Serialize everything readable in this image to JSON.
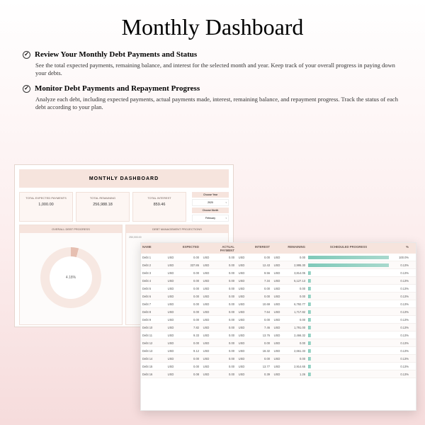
{
  "title": "Monthly Dashboard",
  "section1": {
    "heading": "Review Your Monthly Debt Payments and Status",
    "body": "See the total expected payments, remaining balance, and interest for the selected month and year. Keep track of your overall progress in paying down your debts."
  },
  "section2": {
    "heading": "Monitor Debt Payments and Repayment Progress",
    "body": "Analyze each debt, including expected payments, actual payments made, interest, remaining balance, and repayment progress. Track the status of each debt according to your plan."
  },
  "dash": {
    "heading": "MONTHLY DASHBOARD",
    "stats": {
      "expected_label": "TOTAL EXPECTED PAYMENTS",
      "expected_val": "1,000.00",
      "remaining_label": "TOTAL REMAINING",
      "remaining_val": "256,988.18",
      "interest_label": "TOTAL INTEREST",
      "interest_val": "859.46"
    },
    "choose_year": "Choose Year",
    "year": "2020",
    "choose_month": "Choose Month",
    "month": "February",
    "panel1": "OVERALL DEBT PROGRESS",
    "panel2": "DEBT MANAGEMENT PROJECTIONS",
    "donut_pct": "4.18%",
    "proj_top": "250,000.00"
  },
  "table": {
    "headers": {
      "name": "NAME",
      "expected": "EXPECTED",
      "actual": "ACTUAL PAYMENT",
      "interest": "INTEREST",
      "remaining": "REMAINING",
      "sched": "SCHEDULED PROGRESS",
      "pct": "%"
    },
    "cur": "USD",
    "chart_data": {
      "type": "table",
      "rows": [
        {
          "name": "Debt 1",
          "expected": "0.00",
          "actual": "0.00",
          "interest": "0.00",
          "remaining": "0.00",
          "bar": 100,
          "pct": "100.0%"
        },
        {
          "name": "Debt 2",
          "expected": "337.86",
          "actual": "0.00",
          "interest": "12.43",
          "remaining": "2,995.30",
          "bar": 100,
          "pct": "0.13%"
        },
        {
          "name": "Debt 3",
          "expected": "0.00",
          "actual": "0.00",
          "interest": "9.56",
          "remaining": "3,814.05",
          "bar": 0,
          "pct": "0.13%"
        },
        {
          "name": "Debt 4",
          "expected": "0.00",
          "actual": "0.00",
          "interest": "7.34",
          "remaining": "5,127.13",
          "bar": 0,
          "pct": "0.13%"
        },
        {
          "name": "Debt 5",
          "expected": "0.00",
          "actual": "0.00",
          "interest": "0.00",
          "remaining": "0.00",
          "bar": 0,
          "pct": "0.13%"
        },
        {
          "name": "Debt 6",
          "expected": "0.00",
          "actual": "0.00",
          "interest": "0.00",
          "remaining": "0.00",
          "bar": 0,
          "pct": "0.13%"
        },
        {
          "name": "Debt 7",
          "expected": "0.00",
          "actual": "0.00",
          "interest": "10.69",
          "remaining": "6,792.77",
          "bar": 0,
          "pct": "0.13%"
        },
        {
          "name": "Debt 8",
          "expected": "0.00",
          "actual": "0.00",
          "interest": "7.64",
          "remaining": "1,717.82",
          "bar": 0,
          "pct": "0.13%"
        },
        {
          "name": "Debt 9",
          "expected": "0.00",
          "actual": "0.00",
          "interest": "0.00",
          "remaining": "0.00",
          "bar": 0,
          "pct": "0.13%"
        },
        {
          "name": "Debt 10",
          "expected": "7.82",
          "actual": "0.00",
          "interest": "7.46",
          "remaining": "1,791.00",
          "bar": 0,
          "pct": "0.13%"
        },
        {
          "name": "Debt 11",
          "expected": "9.33",
          "actual": "0.00",
          "interest": "13.76",
          "remaining": "2,466.32",
          "bar": 0,
          "pct": "0.13%"
        },
        {
          "name": "Debt 12",
          "expected": "0.00",
          "actual": "0.00",
          "interest": "0.00",
          "remaining": "0.00",
          "bar": 0,
          "pct": "0.13%"
        },
        {
          "name": "Debt 13",
          "expected": "9.12",
          "actual": "0.00",
          "interest": "18.32",
          "remaining": "2,661.33",
          "bar": 0,
          "pct": "0.13%"
        },
        {
          "name": "Debt 14",
          "expected": "0.00",
          "actual": "0.00",
          "interest": "0.00",
          "remaining": "0.00",
          "bar": 0,
          "pct": "0.13%"
        },
        {
          "name": "Debt 15",
          "expected": "0.00",
          "actual": "0.00",
          "interest": "13.77",
          "remaining": "2,914.65",
          "bar": 0,
          "pct": "0.13%"
        },
        {
          "name": "Debt 16",
          "expected": "0.08",
          "actual": "0.00",
          "interest": "0.39",
          "remaining": "1.26",
          "bar": 0,
          "pct": "0.13%"
        }
      ]
    }
  }
}
